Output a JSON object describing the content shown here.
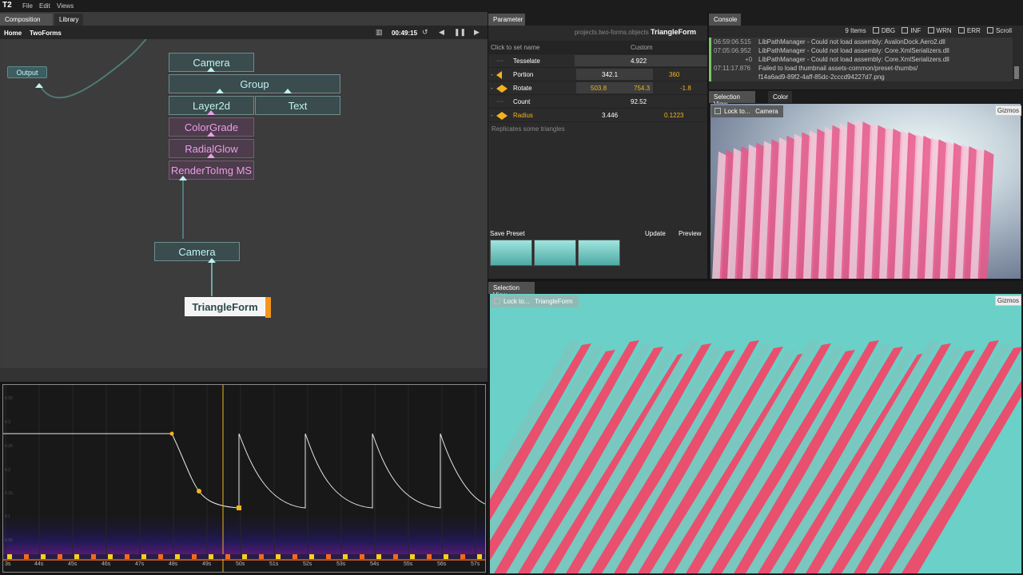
{
  "menubar": {
    "logo": "T2",
    "items": [
      "File",
      "Edit",
      "Views"
    ]
  },
  "composition": {
    "tabs": [
      "Composition",
      "Library"
    ],
    "breadcrumbs": [
      "Home",
      "TwoForms"
    ],
    "timecode": "00:49:15",
    "nodes": {
      "output": "Output",
      "camera_top": "Camera",
      "group": "Group",
      "layer2d": "Layer2d",
      "text": "Text",
      "colorgrade": "ColorGrade",
      "radialglow": "RadialGlow",
      "rendertoimg": "RenderToImg MS",
      "camera_bottom": "Camera",
      "triangleform": "TriangleForm"
    }
  },
  "timeline": {
    "tick_labels": [
      "3s",
      "44s",
      "45s",
      "46s",
      "47s",
      "48s",
      "49s",
      "50s",
      "51s",
      "52s",
      "53s",
      "54s",
      "55s",
      "56s",
      "57s"
    ],
    "y_labels": [
      "0.32",
      "0.3",
      "0.25",
      "0.2",
      "0.15",
      "0.1",
      "0.05"
    ]
  },
  "parameter": {
    "tab": "Parameter",
    "path_prefix": "projects.two-forms.objects",
    "path_object": "TriangleForm",
    "header_left": "Click to set name",
    "header_right": "Custom",
    "rows": [
      {
        "name": "Tesselate",
        "v1": "",
        "v2": "4.922",
        "v3": ""
      },
      {
        "name": "Portion",
        "v1": "342.1",
        "v2": "360",
        "v3": ""
      },
      {
        "name": "Rotate",
        "v1": "503.8",
        "v2": "754.3",
        "v3": "-1.8"
      },
      {
        "name": "Count",
        "v1": "",
        "v2": "92.52",
        "v3": ""
      },
      {
        "name": "Radius",
        "v1": "3.446",
        "v2": "",
        "v3": "0.1223"
      }
    ],
    "description": "Replicates some triangles",
    "save_preset": "Save Preset",
    "update": "Update",
    "preview": "Preview"
  },
  "console": {
    "tab": "Console",
    "count": "9 Items",
    "filters": [
      "DBG",
      "INF",
      "WRN",
      "ERR",
      "Scroll"
    ],
    "logs": [
      {
        "time": "06:59:06.515",
        "msg": "LibPathManager - Could not load assembly: AvalonDock.Aero2.dll"
      },
      {
        "time": "07:05:06.952",
        "msg": "LibPathManager - Could not load assembly: Core.XmlSerializers.dll"
      },
      {
        "time": "+0",
        "msg": "LibPathManager - Could not load assembly: Core.XmlSerializers.dll"
      },
      {
        "time": "07:11:17.876",
        "msg": "Failed to load thumbnail assets-common/preset-thumbs/"
      },
      {
        "time": "",
        "msg": "f14a6ad9-89f2-4aff-85dc-2cccd94227d7.png"
      }
    ]
  },
  "selection_view_top": {
    "tabs": [
      "Selection View",
      "Color"
    ],
    "lock_label": "Lock to...",
    "lock_target": "Camera",
    "gizmos": "Gizmos"
  },
  "selection_view_bottom": {
    "tab": "Selection View",
    "lock_label": "Lock to...",
    "lock_target": "TriangleForm",
    "gizmos": "Gizmos"
  },
  "colors": {
    "accent_orange": "#f3b31d",
    "node_teal": "#bff3ef",
    "node_pink": "#e99fe6",
    "log_ok": "#7cc567"
  }
}
